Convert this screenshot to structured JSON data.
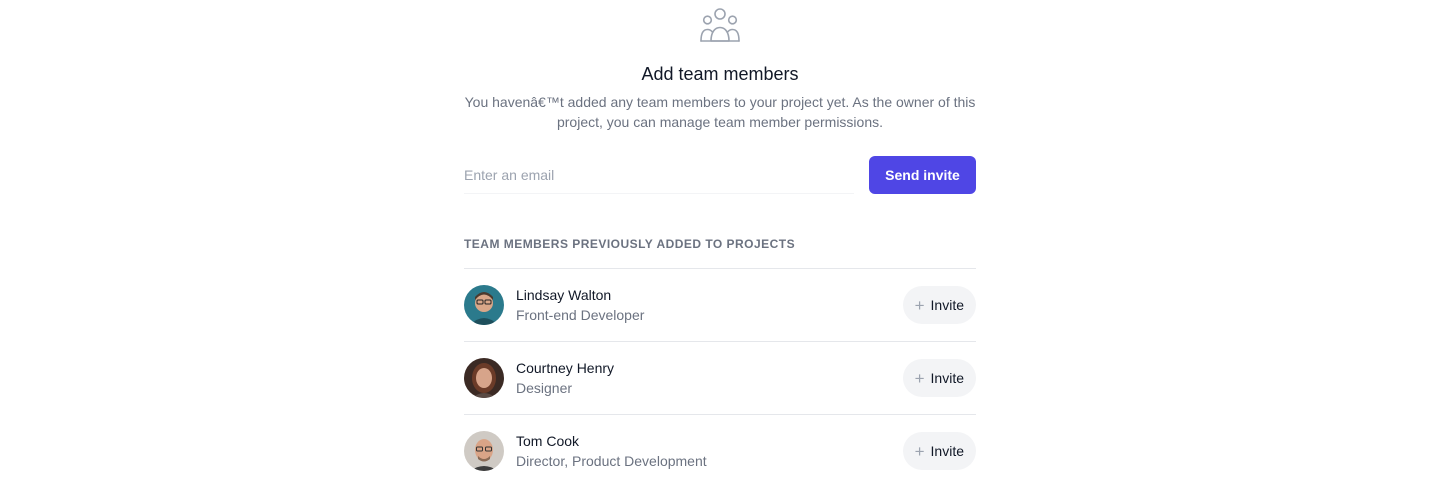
{
  "header": {
    "icon": "user-group-icon",
    "title": "Add team members",
    "description": "You havenâ€™t added any team members to your project yet. As the owner of this project, you can manage team member permissions."
  },
  "invite_form": {
    "email_placeholder": "Enter an email",
    "email_value": "",
    "send_label": "Send invite"
  },
  "section_heading": "TEAM MEMBERS PREVIOUSLY ADDED TO PROJECTS",
  "members": [
    {
      "name": "Lindsay Walton",
      "role": "Front-end Developer",
      "invite_label": "Invite"
    },
    {
      "name": "Courtney Henry",
      "role": "Designer",
      "invite_label": "Invite"
    },
    {
      "name": "Tom Cook",
      "role": "Director, Product Development",
      "invite_label": "Invite"
    }
  ],
  "colors": {
    "accent": "#4f46e5",
    "muted_text": "#6b7280",
    "divider": "#e5e7eb"
  }
}
